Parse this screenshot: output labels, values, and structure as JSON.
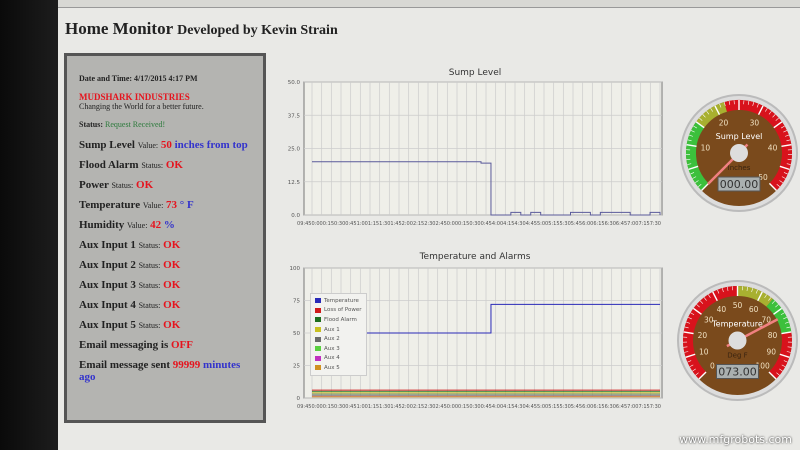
{
  "header": {
    "title": "Home Monitor",
    "subtitle": "Developed by Kevin Strain"
  },
  "panel": {
    "datetime_label": "Date and Time:",
    "datetime": "4/17/2015 4:17 PM",
    "company": "MUDSHARK INDUSTRIES",
    "tagline": "Changing the World for a better future.",
    "status_label": "Status:",
    "status": "Request Received!",
    "rows": [
      {
        "name": "Sump Level",
        "kind": "Value:",
        "value": "50",
        "unit": "inches from top"
      },
      {
        "name": "Flood Alarm",
        "kind": "Status:",
        "value": "OK",
        "unit": ""
      },
      {
        "name": "Power",
        "kind": "Status:",
        "value": "OK",
        "unit": ""
      },
      {
        "name": "Temperature",
        "kind": "Value:",
        "value": "73",
        "unit": "° F"
      },
      {
        "name": "Humidity",
        "kind": "Value:",
        "value": "42",
        "unit": "%"
      },
      {
        "name": "Aux Input 1",
        "kind": "Status:",
        "value": "OK",
        "unit": ""
      },
      {
        "name": "Aux Input 2",
        "kind": "Status:",
        "value": "OK",
        "unit": ""
      },
      {
        "name": "Aux Input 3",
        "kind": "Status:",
        "value": "OK",
        "unit": ""
      },
      {
        "name": "Aux Input 4",
        "kind": "Status:",
        "value": "OK",
        "unit": ""
      },
      {
        "name": "Aux Input 5",
        "kind": "Status:",
        "value": "OK",
        "unit": ""
      }
    ],
    "email_label": "Email messaging is",
    "email_state": "OFF",
    "sent_label": "Email message sent",
    "sent_value": "99999",
    "sent_unit": "minutes ago"
  },
  "chart_data": [
    {
      "type": "line",
      "title": "Sump Level",
      "ylim": [
        0,
        50
      ],
      "yticks": [
        "0.0",
        "12.5",
        "25.0",
        "37.5",
        "50.0"
      ],
      "xtick_text": "09:450:000:150:300:451:001:151:301:452:002:152:302:450:000:150:300:454:004:154:304:455:005:155:305:456:006:156:306:457:007:157:30",
      "series": [
        {
          "name": "Sump Level",
          "color": "#5a5a9a",
          "values": [
            20,
            20,
            20,
            20,
            20,
            20,
            20,
            20,
            20,
            20,
            20,
            20,
            20,
            20,
            20,
            20,
            20,
            19.5,
            0,
            0,
            1,
            0,
            1,
            0,
            0,
            0,
            1,
            1,
            0,
            1,
            1,
            1,
            0,
            0,
            1,
            0
          ]
        }
      ]
    },
    {
      "type": "line",
      "title": "Temperature and Alarms",
      "ylim": [
        0,
        100
      ],
      "yticks": [
        "0",
        "25",
        "50",
        "75",
        "100"
      ],
      "xtick_text": "09:450:000:150:300:451:001:151:301:452:002:152:302:450:000:150:300:454:004:154:304:455:005:155:305:456:006:156:306:457:007:157:30",
      "series": [
        {
          "name": "Temperature",
          "color": "#2a2ab8",
          "values": [
            50,
            50,
            50,
            50,
            50,
            50,
            50,
            50,
            50,
            50,
            50,
            50,
            50,
            50,
            50,
            50,
            50,
            50,
            72,
            72,
            72,
            72,
            72,
            72,
            72,
            72,
            72,
            72,
            72,
            72,
            72,
            72,
            72,
            72,
            72,
            72
          ]
        },
        {
          "name": "Loss of Power",
          "color": "#d01a1a",
          "constant": 6
        },
        {
          "name": "Flood Alarm",
          "color": "#1d6e1d",
          "constant": 5
        },
        {
          "name": "Aux 1",
          "color": "#c8c020",
          "constant": 4
        },
        {
          "name": "Aux 2",
          "color": "#6a6a6a",
          "constant": 3
        },
        {
          "name": "Aux 3",
          "color": "#5ad040",
          "constant": 2
        },
        {
          "name": "Aux 4",
          "color": "#c030c0",
          "constant": 1.5
        },
        {
          "name": "Aux 5",
          "color": "#d09020",
          "constant": 1
        }
      ]
    }
  ],
  "gauges": [
    {
      "title": "Sump Level",
      "unit": "Inches",
      "min": 0,
      "max": 50,
      "value": 0,
      "readout": "000.00",
      "labels": [
        "10",
        "20",
        "30",
        "40",
        "50"
      ],
      "bands": [
        {
          "from": 0,
          "to": 15,
          "color": "#3cc03c"
        },
        {
          "from": 15,
          "to": 22,
          "color": "#a8b030"
        },
        {
          "from": 22,
          "to": 50,
          "color": "#d8121c"
        }
      ]
    },
    {
      "title": "Temperature",
      "unit": "Deg F",
      "min": 0,
      "max": 100,
      "value": 73,
      "readout": "073.00",
      "labels": [
        "0",
        "10",
        "20",
        "30",
        "40",
        "50",
        "60",
        "70",
        "80",
        "90",
        "100"
      ],
      "bands": [
        {
          "from": 0,
          "to": 50,
          "color": "#d8121c"
        },
        {
          "from": 50,
          "to": 65,
          "color": "#a8b030"
        },
        {
          "from": 65,
          "to": 80,
          "color": "#3cc03c"
        },
        {
          "from": 80,
          "to": 100,
          "color": "#d8121c"
        }
      ]
    }
  ],
  "watermark": "www.mfgrobots.com"
}
